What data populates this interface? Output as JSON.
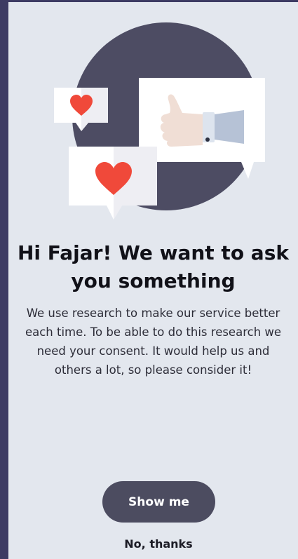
{
  "consent": {
    "title": "Hi Fajar! We want to ask you something",
    "body": "We use research to make our service better each time. To be able to do this research we need your consent. It would help us and others a lot, so please consider it!",
    "primary_label": "Show me",
    "secondary_label": "No, thanks"
  },
  "illustration": {
    "icons": [
      "heart-icon",
      "thumbs-up-icon"
    ]
  },
  "colors": {
    "background": "#e3e7ee",
    "circle": "#4d4c63",
    "heart": "#f0493a",
    "primary_button": "#4c4c60",
    "frame": "#3d3b63"
  }
}
